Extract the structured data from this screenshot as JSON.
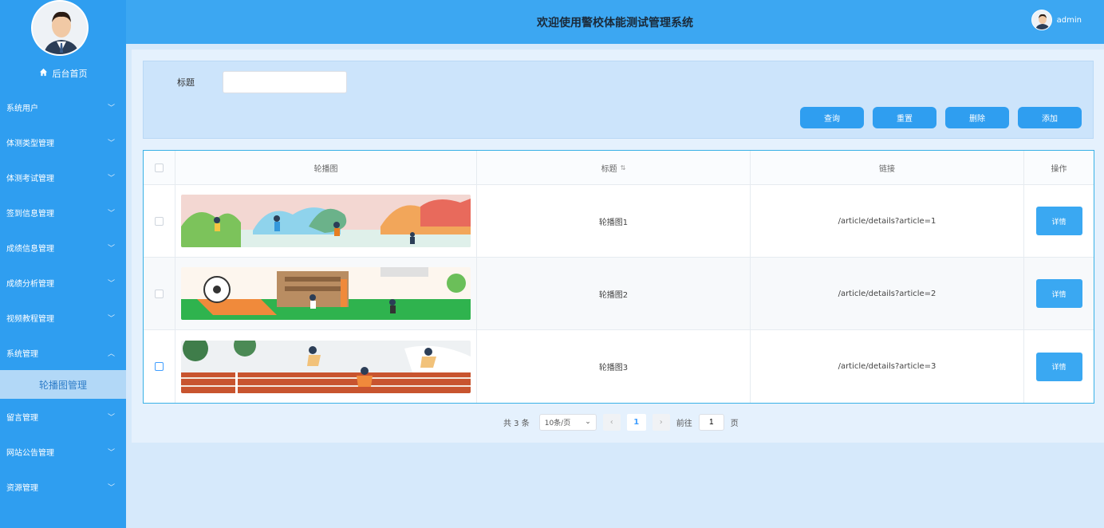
{
  "header": {
    "title": "欢迎使用警校体能测试管理系统",
    "username": "admin"
  },
  "sidebar": {
    "home_label": "后台首页",
    "items": [
      {
        "label": "系统用户",
        "expanded": false
      },
      {
        "label": "体测类型管理",
        "expanded": false
      },
      {
        "label": "体测考试管理",
        "expanded": false
      },
      {
        "label": "签到信息管理",
        "expanded": false
      },
      {
        "label": "成绩信息管理",
        "expanded": false
      },
      {
        "label": "成绩分析管理",
        "expanded": false
      },
      {
        "label": "视频教程管理",
        "expanded": false
      },
      {
        "label": "系统管理",
        "expanded": true
      }
    ],
    "active_sub": "轮播图管理",
    "items_after": [
      {
        "label": "留言管理"
      },
      {
        "label": "网站公告管理"
      },
      {
        "label": "资源管理"
      }
    ]
  },
  "search": {
    "label": "标题",
    "value": "",
    "buttons": {
      "query": "查询",
      "reset": "重置",
      "delete": "删除",
      "add": "添加"
    }
  },
  "table": {
    "columns": {
      "image": "轮播图",
      "title": "标题",
      "link": "链接",
      "action": "操作"
    },
    "detail_label": "详情",
    "rows": [
      {
        "title": "轮播图1",
        "link": "/article/details?article=1"
      },
      {
        "title": "轮播图2",
        "link": "/article/details?article=2"
      },
      {
        "title": "轮播图3",
        "link": "/article/details?article=3"
      }
    ]
  },
  "pagination": {
    "total": "共 3 条",
    "page_size": "10条/页",
    "current_page": "1",
    "goto_prefix": "前往",
    "goto_value": "1",
    "goto_suffix": "页"
  },
  "colors": {
    "sidebar": "#2f9ef0",
    "header": "#3ca7f2",
    "accent": "#2f9ef0",
    "border": "#38b1e6"
  }
}
